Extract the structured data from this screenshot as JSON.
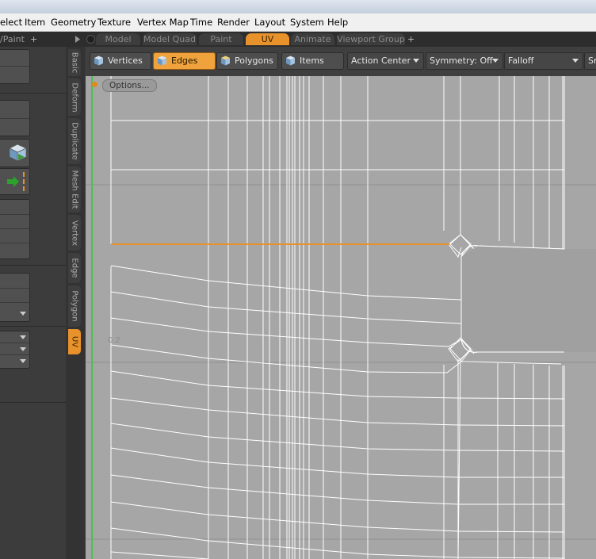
{
  "menubar": {
    "items": [
      "elect",
      "Item",
      "Geometry",
      "Texture",
      "Vertex Map",
      "Time",
      "Render",
      "Layout",
      "System",
      "Help"
    ]
  },
  "tabbar": {
    "left_label": "/Paint",
    "add_label": "+",
    "tabs": [
      "Model",
      "Model Quad",
      "Paint",
      "UV",
      "Animate",
      "Viewport Group"
    ],
    "active_tab": "UV"
  },
  "vertical_tabs": {
    "items": [
      "Basic",
      "Deform",
      "Duplicate",
      "Mesh Edit",
      "Vertex",
      "Edge",
      "Polygon",
      "UV"
    ],
    "active": "UV"
  },
  "toolbar": {
    "modes": [
      {
        "label": "Vertices",
        "icon": "vertex-cube-icon"
      },
      {
        "label": "Edges",
        "icon": "edge-cube-icon"
      },
      {
        "label": "Polygons",
        "icon": "polygon-cube-icon"
      },
      {
        "label": "Items",
        "icon": "item-cube-icon"
      }
    ],
    "active_mode": "Edges",
    "action_center": "Action Center",
    "symmetry": "Symmetry: Off",
    "falloff": "Falloff",
    "snap": "Sn"
  },
  "viewport": {
    "options_label": "Options...",
    "axis_label": "0.2"
  },
  "colors": {
    "accent": "#e8922b",
    "viewport_bg": "#a6a6a6",
    "mesh_line": "#ffffff",
    "selected_edge": "#e8922b",
    "uv_axis": "#49c04d"
  }
}
